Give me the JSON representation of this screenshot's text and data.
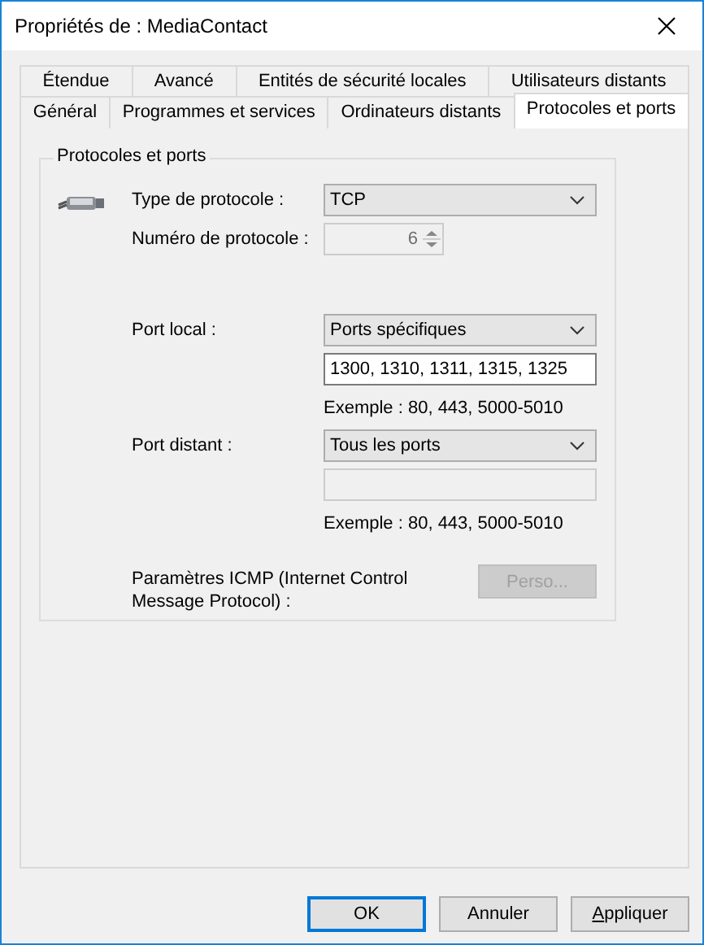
{
  "window": {
    "title": "Propriétés de : MediaContact"
  },
  "tab_rows": [
    {
      "tabs": [
        {
          "label": "Étendue",
          "selected": false
        },
        {
          "label": "Avancé",
          "selected": false
        },
        {
          "label": "Entités de sécurité locales",
          "selected": false
        },
        {
          "label": "Utilisateurs distants",
          "selected": false
        }
      ]
    },
    {
      "tabs": [
        {
          "label": "Général",
          "selected": false
        },
        {
          "label": "Programmes et services",
          "selected": false
        },
        {
          "label": "Ordinateurs distants",
          "selected": false
        },
        {
          "label": "Protocoles et ports",
          "selected": true
        }
      ]
    }
  ],
  "group": {
    "title": "Protocoles et ports",
    "sections": [
      {
        "icon": true,
        "rows": [
          {
            "kind": "dropdown",
            "label": "Type de protocole :",
            "value": "TCP",
            "disabled": false
          },
          {
            "kind": "spinner",
            "label": "Numéro de protocole :",
            "value": "6",
            "disabled": true
          }
        ]
      },
      {
        "icon": false,
        "rows": [
          {
            "kind": "dropdown",
            "label": "Port local :",
            "value": "Ports spécifiques",
            "disabled": false
          },
          {
            "kind": "text",
            "value": "1300, 1310, 1311, 1315, 1325",
            "disabled": false
          },
          {
            "kind": "hint",
            "value": "Exemple : 80, 443, 5000-5010"
          },
          {
            "kind": "dropdown",
            "label": "Port distant :",
            "value": "Tous les ports",
            "disabled": false
          },
          {
            "kind": "text",
            "disabled": true
          },
          {
            "kind": "hint",
            "value": "Exemple : 80, 443, 5000-5010"
          }
        ]
      },
      {
        "icon": false,
        "rows": [
          {
            "kind": "button",
            "label": "Paramètres ICMP (Internet Control Message Protocol) :",
            "value": "Perso...",
            "disabled": true
          }
        ]
      }
    ]
  },
  "buttons": [
    {
      "label": "OK",
      "default": true,
      "mnemonic": false
    },
    {
      "label": "Annuler",
      "default": false,
      "mnemonic": false
    },
    {
      "label": "Appliquer",
      "default": false,
      "mnemonic": true
    }
  ]
}
